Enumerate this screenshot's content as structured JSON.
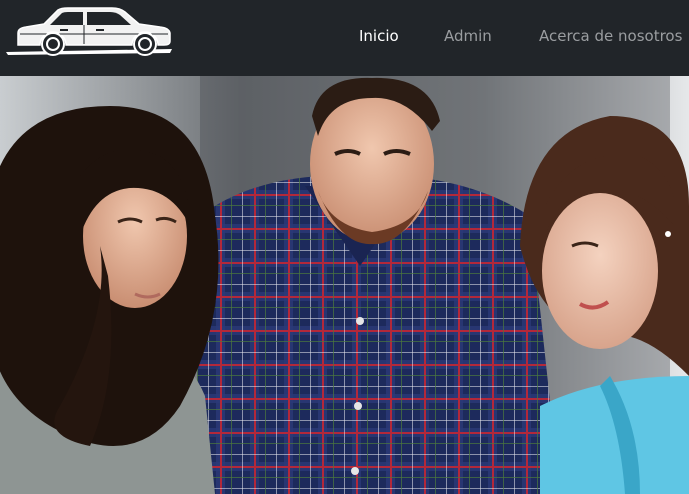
{
  "navbar": {
    "brand_icon": "car-logo-icon",
    "links": [
      {
        "label": "Inicio",
        "active": true
      },
      {
        "label": "Admin",
        "active": false
      },
      {
        "label": "Acerca de nosotros",
        "active": false
      }
    ]
  },
  "hero": {
    "image": "three-people-looking-down-photo"
  },
  "colors": {
    "navbar_bg": "#212529",
    "nav_active": "#ffffff",
    "nav_inactive": "#9a9da0"
  }
}
